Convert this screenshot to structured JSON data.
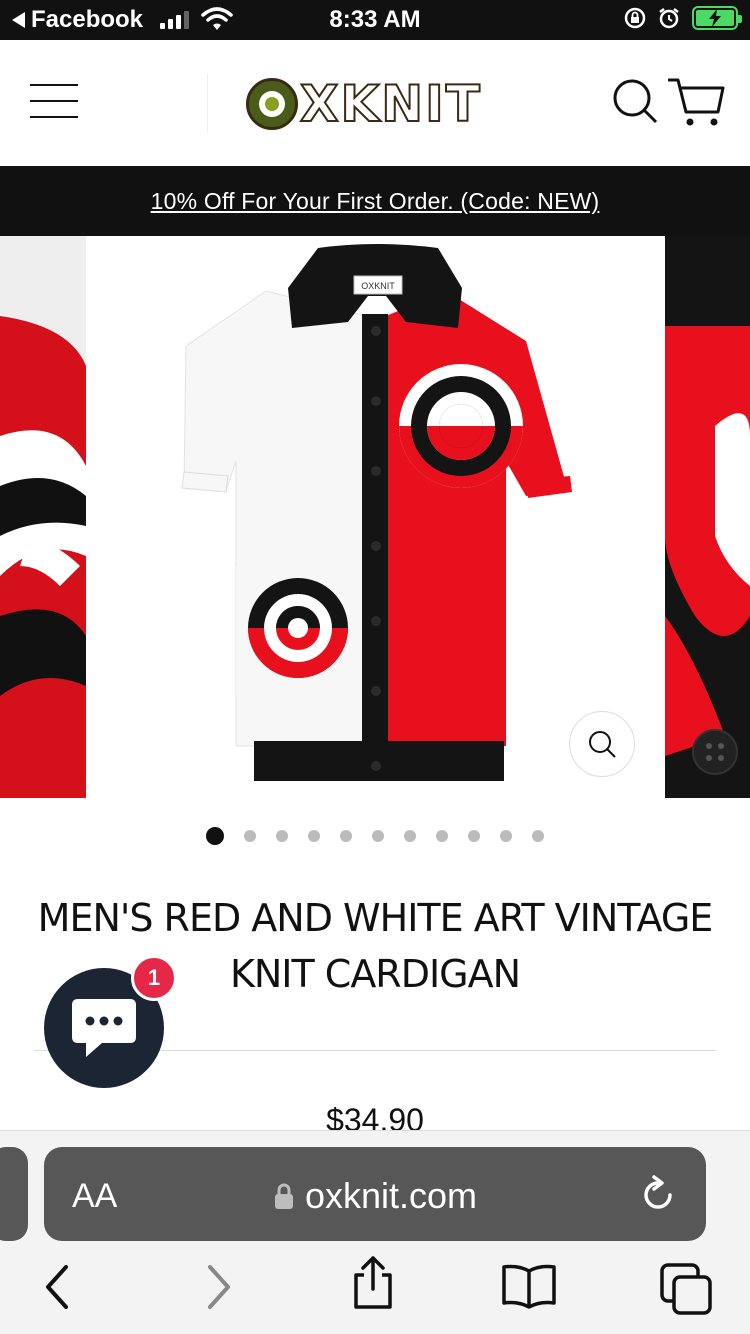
{
  "status_bar": {
    "back_app": "Facebook",
    "time": "8:33 AM"
  },
  "header": {
    "logo_text": "XKNIT",
    "logo_full": "OXKNIT"
  },
  "promo": {
    "text": "10% Off For Your First Order. (Code: NEW)"
  },
  "carousel": {
    "slide_count": 11,
    "active_index": 0,
    "product_label_tag": "OXKNIT"
  },
  "product": {
    "title": "MEN'S RED AND WHITE ART VINTAGE KNIT CARDIGAN",
    "price": "$34.90"
  },
  "chat": {
    "badge_count": "1"
  },
  "browser": {
    "aa_label": "AA",
    "url": "oxknit.com"
  },
  "colors": {
    "accent_red": "#e8101c",
    "black": "#111111",
    "badge": "#e62848",
    "chat": "#1b2533",
    "logo_green": "#4a5b1a"
  },
  "icons": [
    "hamburger-icon",
    "search-icon",
    "cart-icon",
    "zoom-icon",
    "chat-icon",
    "lock-icon",
    "reload-icon",
    "back-icon",
    "forward-icon",
    "share-icon",
    "bookmarks-icon",
    "tabs-icon"
  ]
}
